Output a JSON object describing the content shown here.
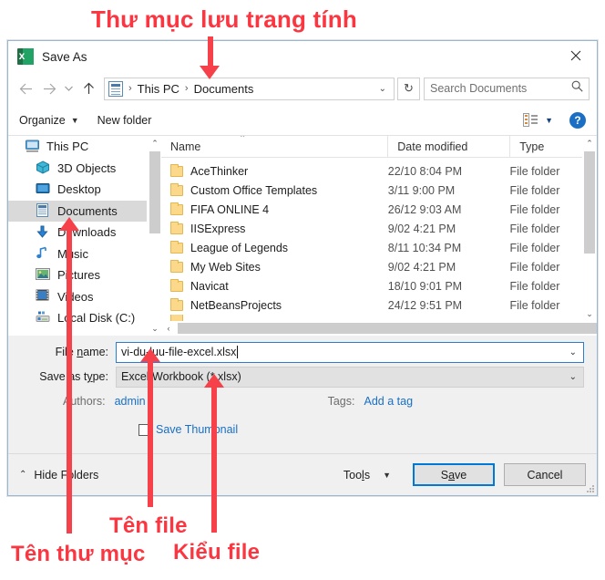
{
  "annotations": {
    "top": "Thư mục lưu trang tính",
    "folder_name": "Tên thư mục",
    "file_name": "Tên file",
    "file_type": "Kiểu file"
  },
  "dialog": {
    "title": "Save As",
    "close_label": "✕"
  },
  "nav": {
    "back": "←",
    "forward": "→",
    "recent": "⌄",
    "up": "↑",
    "breadcrumbs": [
      "This PC",
      "Documents"
    ],
    "separator": "›",
    "dropdown_caret": "⌄",
    "refresh": "↻",
    "search_placeholder": "Search Documents",
    "search_value": ""
  },
  "toolbar": {
    "organize": "Organize",
    "organize_caret": "▼",
    "new_folder": "New folder",
    "view_caret": "▼",
    "help": "?"
  },
  "sidebar": {
    "items": [
      {
        "label": "This PC",
        "icon": "monitor-icon",
        "indent": false,
        "selected": false
      },
      {
        "label": "3D Objects",
        "icon": "cube-icon",
        "indent": true,
        "selected": false
      },
      {
        "label": "Desktop",
        "icon": "desktop-icon",
        "indent": true,
        "selected": false
      },
      {
        "label": "Documents",
        "icon": "documents-icon",
        "indent": true,
        "selected": true
      },
      {
        "label": "Downloads",
        "icon": "download-icon",
        "indent": true,
        "selected": false
      },
      {
        "label": "Music",
        "icon": "music-icon",
        "indent": true,
        "selected": false
      },
      {
        "label": "Pictures",
        "icon": "pictures-icon",
        "indent": true,
        "selected": false
      },
      {
        "label": "Videos",
        "icon": "videos-icon",
        "indent": true,
        "selected": false
      },
      {
        "label": "Local Disk (C:)",
        "icon": "disk-icon",
        "indent": true,
        "selected": false
      }
    ],
    "scroll_up": "⌃",
    "scroll_down": "⌄"
  },
  "filelist": {
    "columns": [
      "Name",
      "Date modified",
      "Type"
    ],
    "sort_indicator": "⌃",
    "rows": [
      {
        "name": "AceThinker",
        "date": "22/10 8:04 PM",
        "type": "File folder"
      },
      {
        "name": "Custom Office Templates",
        "date": "3/11 9:00 PM",
        "type": "File folder"
      },
      {
        "name": "FIFA ONLINE 4",
        "date": "26/12 9:03 AM",
        "type": "File folder"
      },
      {
        "name": "IISExpress",
        "date": "9/02 4:21 PM",
        "type": "File folder"
      },
      {
        "name": "League of Legends",
        "date": "8/11 10:34 PM",
        "type": "File folder"
      },
      {
        "name": "My Web Sites",
        "date": "9/02 4:21 PM",
        "type": "File folder"
      },
      {
        "name": "Navicat",
        "date": "18/10 9:01 PM",
        "type": "File folder"
      },
      {
        "name": "NetBeansProjects",
        "date": "24/12 9:51 PM",
        "type": "File folder"
      }
    ],
    "scroll_up": "⌃",
    "scroll_down": "⌄",
    "scroll_left": "‹",
    "scroll_right": "›"
  },
  "form": {
    "file_name_label_a": "File ",
    "file_name_label_u": "n",
    "file_name_label_b": "ame:",
    "file_name_value": "vi-du-luu-file-excel.xlsx",
    "save_type_label_a": "Save as t",
    "save_type_label_u": "y",
    "save_type_label_b": "pe:",
    "save_type_value": "Excel Workbook (*.xlsx)",
    "dropdown_caret": "⌄",
    "authors_label": "Authors:",
    "authors_value": "admin",
    "tags_label": "Tags:",
    "tags_value": "Add a tag",
    "save_thumbnail": "Save Thumbnail",
    "save_thumbnail_checked": false
  },
  "footer": {
    "hide_folders_caret": "⌃",
    "hide_folders": "Hide Folders",
    "tools_a": "Too",
    "tools_u": "l",
    "tools_b": "s",
    "tools_caret": "▼",
    "save_a": "S",
    "save_u": "a",
    "save_b": "ve",
    "cancel": "Cancel"
  },
  "colors": {
    "annotation_red": "#fb3640",
    "accent_blue": "#0078d7",
    "link_blue": "#1a6fc4",
    "excel_green": "#21a366"
  }
}
